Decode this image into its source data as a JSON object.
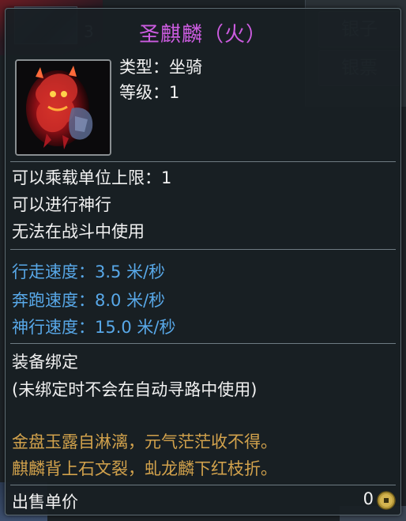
{
  "background": {
    "slot_count": "3",
    "buttons": [
      "银子",
      "银票"
    ]
  },
  "tooltip": {
    "item_name": "圣麒麟（火）",
    "item_name_color": "#cc5ce0",
    "item_icon": "red-flaming-qilin-mount-icon",
    "type_line": "类型：坐骑",
    "level_line": "等级：1",
    "properties": [
      "可以乘载单位上限：1",
      "可以进行神行",
      "无法在战斗中使用"
    ],
    "stats": [
      "行走速度：3.5 米/秒",
      "奔跑速度：8.0 米/秒",
      "神行速度：15.0 米/秒"
    ],
    "stat_color": "#58a8e8",
    "binding": [
      "装备绑定",
      "(未绑定时不会在自动寻路中使用)"
    ],
    "flavor_text": [
      "金盘玉露自淋漓，元气茫茫收不得。",
      "麒麟背上石文裂，虬龙麟下红枝折。"
    ],
    "flavor_color": "#d2a24c",
    "price_label": "出售单价",
    "price_value": "0",
    "price_icon": "copper-coin-icon"
  }
}
